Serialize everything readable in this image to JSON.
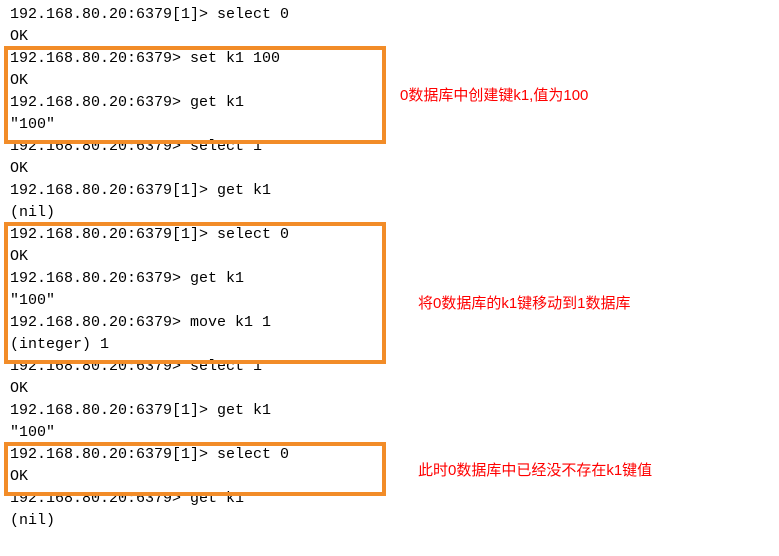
{
  "lines": [
    "192.168.80.20:6379[1]> select 0",
    "OK",
    "192.168.80.20:6379> set k1 100",
    "OK",
    "192.168.80.20:6379> get k1",
    "\"100\"",
    "192.168.80.20:6379> select 1",
    "OK",
    "192.168.80.20:6379[1]> get k1",
    "(nil)",
    "192.168.80.20:6379[1]> select 0",
    "OK",
    "192.168.80.20:6379> get k1",
    "\"100\"",
    "192.168.80.20:6379> move k1 1",
    "(integer) 1",
    "192.168.80.20:6379> select 1",
    "OK",
    "192.168.80.20:6379[1]> get k1",
    "\"100\"",
    "192.168.80.20:6379[1]> select 0",
    "OK",
    "192.168.80.20:6379> get k1",
    "(nil)"
  ],
  "annotations": [
    "0数据库中创建键k1,值为100",
    "将0数据库的k1键移动到1数据库",
    "此时0数据库中已经没不存在k1键值"
  ]
}
